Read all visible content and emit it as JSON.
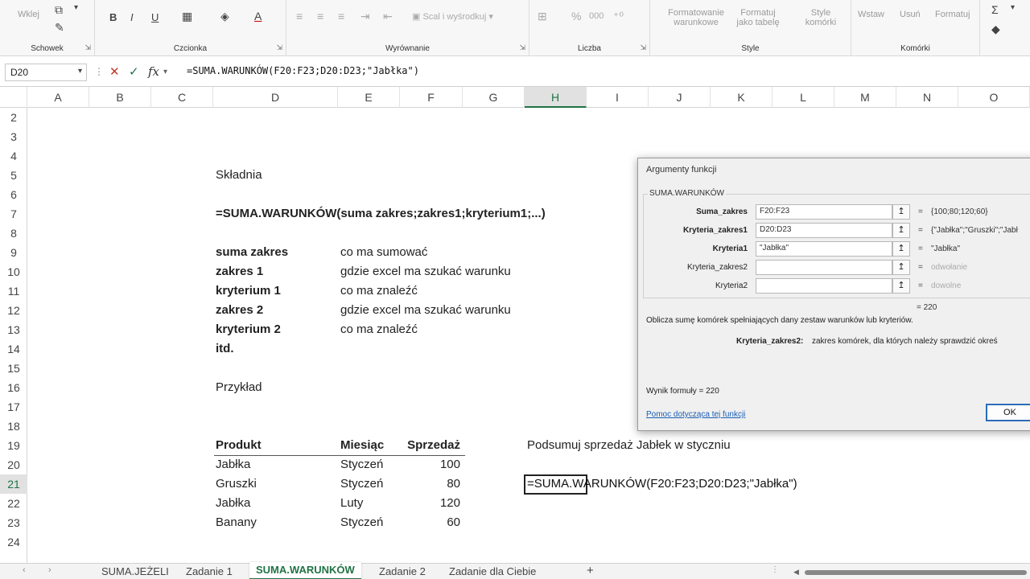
{
  "ribbon": {
    "groups": {
      "clipboard": "Schowek",
      "font": "Czcionka",
      "alignment": "Wyrównanie",
      "number": "Liczba",
      "style": "Style",
      "cells": "Komórki"
    },
    "paste_label": "Wklej",
    "merge_label": "Scal i wyśrodkuj",
    "conditional_formatting": "Formatowanie warunkowe",
    "format_as_table": "Formatuj jako tabelę",
    "cell_styles": "Style komórki",
    "insert": "Wstaw",
    "delete": "Usuń",
    "format": "Formatuj",
    "bold": "B",
    "italic": "I",
    "underline": "U",
    "number_format_percent": "%",
    "number_format_thousands": "000"
  },
  "formula_bar": {
    "name_box": "D20",
    "fx": "fx",
    "formula": "=SUMA.WARUNKÓW(F20:F23;D20:D23;\"Jabłka\")"
  },
  "columns": [
    "A",
    "B",
    "C",
    "D",
    "E",
    "F",
    "G",
    "H",
    "I",
    "J",
    "K",
    "L",
    "M",
    "N",
    "O"
  ],
  "rows": [
    "2",
    "3",
    "4",
    "5",
    "6",
    "7",
    "8",
    "9",
    "10",
    "11",
    "12",
    "13",
    "14",
    "15",
    "16",
    "17",
    "18",
    "19",
    "20",
    "21",
    "22",
    "23",
    "24"
  ],
  "sheet": {
    "syntax_title": "Składnia",
    "syntax_formula": "=SUMA.WARUNKÓW(suma zakres;zakres1;kryterium1;...)",
    "params": [
      {
        "name": "suma zakres",
        "desc": "co ma sumować"
      },
      {
        "name": "zakres 1",
        "desc": "gdzie excel ma szukać warunku"
      },
      {
        "name": "kryterium 1",
        "desc": "co ma znaleźć"
      },
      {
        "name": "zakres 2",
        "desc": "gdzie excel ma szukać warunku"
      },
      {
        "name": "kryterium 2",
        "desc": "co ma znaleźć"
      },
      {
        "name": "itd.",
        "desc": ""
      }
    ],
    "example_title": "Przykład",
    "table_headers": [
      "Produkt",
      "Miesiąc",
      "Sprzedaż"
    ],
    "table_rows": [
      [
        "Jabłka",
        "Styczeń",
        "100"
      ],
      [
        "Gruszki",
        "Styczeń",
        "80"
      ],
      [
        "Jabłka",
        "Luty",
        "120"
      ],
      [
        "Banany",
        "Styczeń",
        "60"
      ]
    ],
    "task_text": "Podsumuj sprzedaż Jabłek w styczniu",
    "edit_formula": "=SUMA.WARUNKÓW(F20:F23;D20:D23;\"Jabłka\")"
  },
  "dialog": {
    "title": "Argumenty funkcji",
    "function_name": "SUMA.WARUNKÓW",
    "args": [
      {
        "label": "Suma_zakres",
        "value": "F20:F23",
        "result": "{100;80;120;60}",
        "grey": false
      },
      {
        "label": "Kryteria_zakres1",
        "value": "D20:D23",
        "result": "{\"Jabłka\";\"Gruszki\";\"Jabł",
        "grey": false
      },
      {
        "label": "Kryteria1",
        "value": "\"Jabłka\"",
        "result": "\"Jabłka\"",
        "grey": false
      },
      {
        "label": "Kryteria_zakres2",
        "value": "",
        "result": "odwołanie",
        "grey": true
      },
      {
        "label": "Kryteria2",
        "value": "",
        "result": "dowolne",
        "grey": true
      }
    ],
    "equals": "=",
    "picker_icon": "↥",
    "top_result": "= 220",
    "description": "Oblicza sumę komórek spełniających dany zestaw warunków lub kryteriów.",
    "arg_help_name": "Kryteria_zakres2:",
    "arg_help_text": "zakres komórek, dla których należy sprawdzić okreś",
    "formula_result": "Wynik formuły =   220",
    "help_link": "Pomoc dotycząca tej funkcji",
    "ok": "OK"
  },
  "tabs": {
    "items": [
      "SUMA.JEŻELI",
      "Zadanie 1",
      "SUMA.WARUNKÓW",
      "Zadanie 2",
      "Zadanie dla Ciebie"
    ],
    "active": "SUMA.WARUNKÓW",
    "add": "+"
  }
}
